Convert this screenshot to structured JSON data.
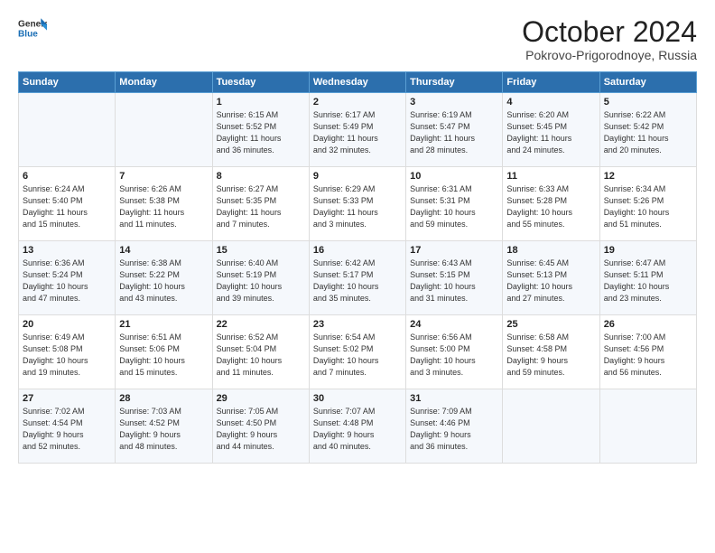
{
  "header": {
    "logo_line1": "General",
    "logo_line2": "Blue",
    "month": "October 2024",
    "location": "Pokrovo-Prigorodnoye, Russia"
  },
  "weekdays": [
    "Sunday",
    "Monday",
    "Tuesday",
    "Wednesday",
    "Thursday",
    "Friday",
    "Saturday"
  ],
  "weeks": [
    [
      {
        "day": "",
        "info": ""
      },
      {
        "day": "",
        "info": ""
      },
      {
        "day": "1",
        "info": "Sunrise: 6:15 AM\nSunset: 5:52 PM\nDaylight: 11 hours\nand 36 minutes."
      },
      {
        "day": "2",
        "info": "Sunrise: 6:17 AM\nSunset: 5:49 PM\nDaylight: 11 hours\nand 32 minutes."
      },
      {
        "day": "3",
        "info": "Sunrise: 6:19 AM\nSunset: 5:47 PM\nDaylight: 11 hours\nand 28 minutes."
      },
      {
        "day": "4",
        "info": "Sunrise: 6:20 AM\nSunset: 5:45 PM\nDaylight: 11 hours\nand 24 minutes."
      },
      {
        "day": "5",
        "info": "Sunrise: 6:22 AM\nSunset: 5:42 PM\nDaylight: 11 hours\nand 20 minutes."
      }
    ],
    [
      {
        "day": "6",
        "info": "Sunrise: 6:24 AM\nSunset: 5:40 PM\nDaylight: 11 hours\nand 15 minutes."
      },
      {
        "day": "7",
        "info": "Sunrise: 6:26 AM\nSunset: 5:38 PM\nDaylight: 11 hours\nand 11 minutes."
      },
      {
        "day": "8",
        "info": "Sunrise: 6:27 AM\nSunset: 5:35 PM\nDaylight: 11 hours\nand 7 minutes."
      },
      {
        "day": "9",
        "info": "Sunrise: 6:29 AM\nSunset: 5:33 PM\nDaylight: 11 hours\nand 3 minutes."
      },
      {
        "day": "10",
        "info": "Sunrise: 6:31 AM\nSunset: 5:31 PM\nDaylight: 10 hours\nand 59 minutes."
      },
      {
        "day": "11",
        "info": "Sunrise: 6:33 AM\nSunset: 5:28 PM\nDaylight: 10 hours\nand 55 minutes."
      },
      {
        "day": "12",
        "info": "Sunrise: 6:34 AM\nSunset: 5:26 PM\nDaylight: 10 hours\nand 51 minutes."
      }
    ],
    [
      {
        "day": "13",
        "info": "Sunrise: 6:36 AM\nSunset: 5:24 PM\nDaylight: 10 hours\nand 47 minutes."
      },
      {
        "day": "14",
        "info": "Sunrise: 6:38 AM\nSunset: 5:22 PM\nDaylight: 10 hours\nand 43 minutes."
      },
      {
        "day": "15",
        "info": "Sunrise: 6:40 AM\nSunset: 5:19 PM\nDaylight: 10 hours\nand 39 minutes."
      },
      {
        "day": "16",
        "info": "Sunrise: 6:42 AM\nSunset: 5:17 PM\nDaylight: 10 hours\nand 35 minutes."
      },
      {
        "day": "17",
        "info": "Sunrise: 6:43 AM\nSunset: 5:15 PM\nDaylight: 10 hours\nand 31 minutes."
      },
      {
        "day": "18",
        "info": "Sunrise: 6:45 AM\nSunset: 5:13 PM\nDaylight: 10 hours\nand 27 minutes."
      },
      {
        "day": "19",
        "info": "Sunrise: 6:47 AM\nSunset: 5:11 PM\nDaylight: 10 hours\nand 23 minutes."
      }
    ],
    [
      {
        "day": "20",
        "info": "Sunrise: 6:49 AM\nSunset: 5:08 PM\nDaylight: 10 hours\nand 19 minutes."
      },
      {
        "day": "21",
        "info": "Sunrise: 6:51 AM\nSunset: 5:06 PM\nDaylight: 10 hours\nand 15 minutes."
      },
      {
        "day": "22",
        "info": "Sunrise: 6:52 AM\nSunset: 5:04 PM\nDaylight: 10 hours\nand 11 minutes."
      },
      {
        "day": "23",
        "info": "Sunrise: 6:54 AM\nSunset: 5:02 PM\nDaylight: 10 hours\nand 7 minutes."
      },
      {
        "day": "24",
        "info": "Sunrise: 6:56 AM\nSunset: 5:00 PM\nDaylight: 10 hours\nand 3 minutes."
      },
      {
        "day": "25",
        "info": "Sunrise: 6:58 AM\nSunset: 4:58 PM\nDaylight: 9 hours\nand 59 minutes."
      },
      {
        "day": "26",
        "info": "Sunrise: 7:00 AM\nSunset: 4:56 PM\nDaylight: 9 hours\nand 56 minutes."
      }
    ],
    [
      {
        "day": "27",
        "info": "Sunrise: 7:02 AM\nSunset: 4:54 PM\nDaylight: 9 hours\nand 52 minutes."
      },
      {
        "day": "28",
        "info": "Sunrise: 7:03 AM\nSunset: 4:52 PM\nDaylight: 9 hours\nand 48 minutes."
      },
      {
        "day": "29",
        "info": "Sunrise: 7:05 AM\nSunset: 4:50 PM\nDaylight: 9 hours\nand 44 minutes."
      },
      {
        "day": "30",
        "info": "Sunrise: 7:07 AM\nSunset: 4:48 PM\nDaylight: 9 hours\nand 40 minutes."
      },
      {
        "day": "31",
        "info": "Sunrise: 7:09 AM\nSunset: 4:46 PM\nDaylight: 9 hours\nand 36 minutes."
      },
      {
        "day": "",
        "info": ""
      },
      {
        "day": "",
        "info": ""
      }
    ]
  ]
}
